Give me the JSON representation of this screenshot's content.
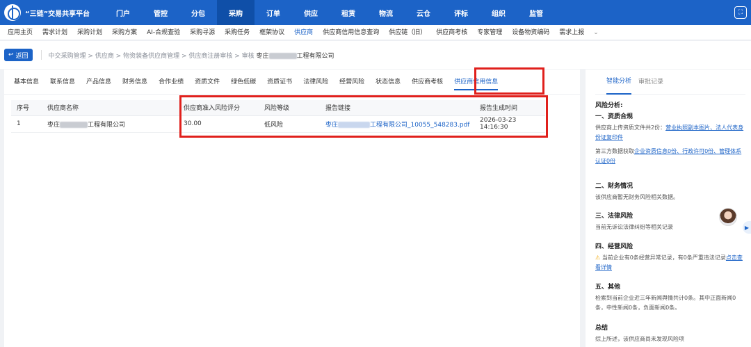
{
  "app": {
    "title": "“三链”交易共享平台"
  },
  "top_nav": [
    "门户",
    "管控",
    "分包",
    "采购",
    "订单",
    "供应",
    "租赁",
    "物流",
    "云仓",
    "评标",
    "组织",
    "监管"
  ],
  "top_nav_active_index": 3,
  "sub_nav": [
    "应用主页",
    "需求计划",
    "采购计划",
    "采购方案",
    "AI-合规查验",
    "采购寻源",
    "采购任务",
    "框架协议",
    "供应商",
    "供应商信用信息查询",
    "供应链（旧）",
    "供应商考核",
    "专家管理",
    "设备物资编码",
    "需求上报"
  ],
  "sub_nav_active_index": 8,
  "sub_nav_more": "⌄",
  "back_button": {
    "icon": "↩",
    "label": "返回"
  },
  "breadcrumb": {
    "path": "中交采购管理 > 供应商 > 物资装备供应商管理 > 供应商注册审核 > 审核",
    "current_prefix": "枣庄",
    "current_suffix": "工程有限公司"
  },
  "tabs": [
    "基本信息",
    "联系信息",
    "产品信息",
    "财务信息",
    "合作业绩",
    "资质文件",
    "绿色低碳",
    "资质证书",
    "法律风险",
    "经营风险",
    "状态信息",
    "供应商考核",
    "供应商信用信息"
  ],
  "tab_active_index": 12,
  "table": {
    "headers": [
      "序号",
      "供应商名称",
      "供应商准入风险评分",
      "风险等级",
      "报告链接",
      "报告生成时间"
    ],
    "rows": [
      {
        "index": "1",
        "name_prefix": "枣庄",
        "name_suffix": "工程有限公司",
        "score": "30.00",
        "risk": "低风险",
        "link_prefix": "枣庄",
        "link_suffix": "工程有限公司_10055_548283.pdf",
        "time": "2026-03-23 14:16:30"
      }
    ]
  },
  "side_tabs": [
    "智能分析",
    "审批记录"
  ],
  "side_tab_active_index": 0,
  "analysis": {
    "heading": "风险分析:",
    "s1_title": "一、资质合规",
    "s1_text": "供应商上传资质文件共2份：",
    "s1_link": "营业执照副本图片、法人代表身份证复印件",
    "s1_text2": "第三方数据获取",
    "s1_link2": "企业资质信息0份、行政许可0份、管理体系认证0份",
    "s2_title": "二、财务情况",
    "s2_text": "该供应商暂无财务风险相关数据。",
    "s3_title": "三、法律风险",
    "s3_text": "当前无诉讼法律纠纷等相关记录",
    "s4_title": "四、经营风险",
    "s4_icon": "⚠",
    "s4_text": "当前企业有0条经营异常记录，有0条严重违法记录",
    "s4_link": "点击查看详情",
    "s5_title": "五、其他",
    "s5_text": "检索到当前企业近三年新闻舆情共计0条。其中正面新闻0条，中性新闻0条，负面新闻0条。",
    "summary_title": "总结",
    "summary_text": "综上所述，该供应商尚未发现风险项"
  }
}
